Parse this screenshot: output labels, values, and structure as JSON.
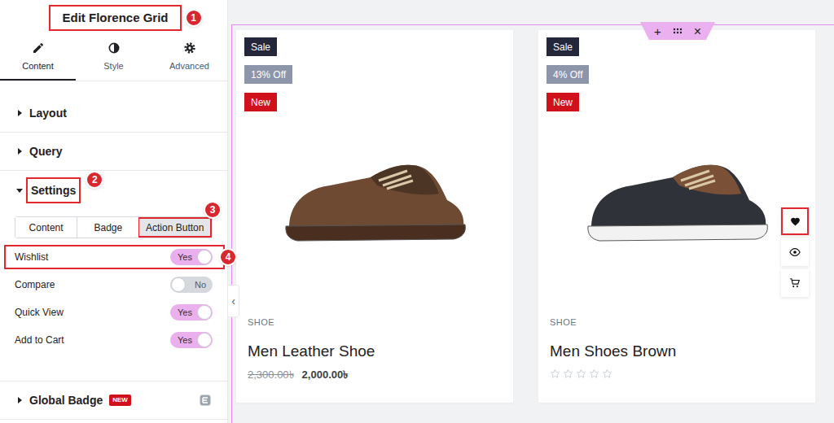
{
  "panel": {
    "title": {
      "text": "Edit Florence Grid",
      "annotation": "1"
    },
    "tabs": [
      {
        "label": "Content",
        "selected": true,
        "kind": "pencil"
      },
      {
        "label": "Style",
        "selected": false,
        "kind": "contrast"
      },
      {
        "label": "Advanced",
        "selected": false,
        "kind": "gear"
      }
    ],
    "sections": [
      {
        "label": "Layout",
        "expanded": false
      },
      {
        "label": "Query",
        "expanded": false
      },
      {
        "label": "Settings",
        "expanded": true,
        "annotation": "2"
      }
    ],
    "settings": {
      "subtabs": [
        {
          "label": "Content",
          "selected": false
        },
        {
          "label": "Badge",
          "selected": false
        },
        {
          "label": "Action Button",
          "selected": true,
          "annotation": "3"
        }
      ],
      "toggles": [
        {
          "label": "Wishlist",
          "on": true,
          "text": "Yes",
          "annotation": "4"
        },
        {
          "label": "Compare",
          "on": false,
          "text": "No"
        },
        {
          "label": "Quick View",
          "on": true,
          "text": "Yes"
        },
        {
          "label": "Add to Cart",
          "on": true,
          "text": "Yes"
        }
      ]
    },
    "global_badge": {
      "label": "Global Badge",
      "badge": "NEW"
    },
    "collapse": "‹"
  },
  "canvas_toolbar": {
    "add": "+",
    "close": "×"
  },
  "cards": [
    {
      "badges": [
        {
          "label": "Sale",
          "color": "#24263a"
        },
        {
          "label": "13% Off",
          "color": "#8c95aa"
        },
        {
          "label": "New",
          "color": "#d0101b"
        }
      ],
      "category": "SHOE",
      "title": "Men Leather Shoe",
      "price_old": "2,300.00৳",
      "price": "2,000.00৳"
    },
    {
      "badges": [
        {
          "label": "Sale",
          "color": "#24263a"
        },
        {
          "label": "4% Off",
          "color": "#8c95aa"
        },
        {
          "label": "New",
          "color": "#d0101b"
        }
      ],
      "category": "SHOE",
      "title": "Men Shoes Brown",
      "stars": 0,
      "actions": [
        {
          "kind": "wishlist",
          "highlighted": true
        },
        {
          "kind": "quick-view",
          "highlighted": false
        },
        {
          "kind": "cart",
          "highlighted": false
        }
      ]
    }
  ]
}
